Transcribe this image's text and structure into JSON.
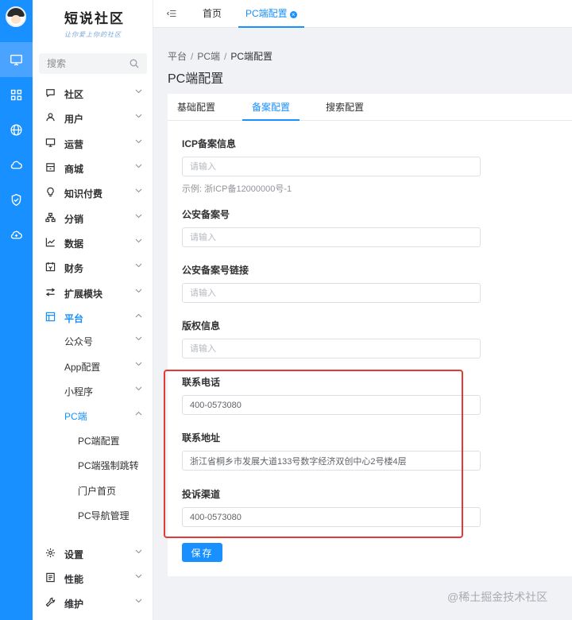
{
  "app": {
    "logo_title": "短说社区",
    "logo_subtitle": "让你爱上你的社区"
  },
  "rail": {
    "items": [
      {
        "icon": "monitor-icon",
        "active": true
      },
      {
        "icon": "grid-icon",
        "active": false
      },
      {
        "icon": "globe-icon",
        "active": false
      },
      {
        "icon": "cloud-icon",
        "active": false
      },
      {
        "icon": "shield-check-icon",
        "active": false
      },
      {
        "icon": "cloud-sync-icon",
        "active": false
      }
    ]
  },
  "menu": {
    "search_placeholder": "搜索",
    "items": [
      {
        "label": "社区",
        "icon": "chat-icon"
      },
      {
        "label": "用户",
        "icon": "user-icon"
      },
      {
        "label": "运营",
        "icon": "screen-icon"
      },
      {
        "label": "商城",
        "icon": "shop-icon"
      },
      {
        "label": "知识付费",
        "icon": "bulb-icon"
      },
      {
        "label": "分销",
        "icon": "hierarchy-icon"
      },
      {
        "label": "数据",
        "icon": "chart-line-icon"
      },
      {
        "label": "财务",
        "icon": "finance-icon"
      },
      {
        "label": "扩展模块",
        "icon": "extend-icon"
      },
      {
        "label": "平台",
        "icon": "platform-icon",
        "active": true
      }
    ],
    "platform_children": [
      {
        "label": "公众号"
      },
      {
        "label": "App配置"
      },
      {
        "label": "小程序"
      },
      {
        "label": "PC端",
        "active": true
      }
    ],
    "pc_children": [
      "PC端配置",
      "PC端强制跳转",
      "门户首页",
      "PC导航管理"
    ],
    "bottom_items": [
      {
        "label": "设置",
        "icon": "gear-icon"
      },
      {
        "label": "性能",
        "icon": "performance-icon"
      },
      {
        "label": "维护",
        "icon": "wrench-icon"
      }
    ]
  },
  "topbar": {
    "tabs": [
      {
        "label": "首页"
      },
      {
        "label": "PC端配置",
        "active": true
      }
    ]
  },
  "breadcrumb": [
    "平台",
    "PC端",
    "PC端配置"
  ],
  "page_title": "PC端配置",
  "content_tabs": [
    {
      "label": "基础配置"
    },
    {
      "label": "备案配置",
      "active": true
    },
    {
      "label": "搜索配置"
    }
  ],
  "form": {
    "icp": {
      "label": "ICP备案信息",
      "value": "",
      "placeholder": "请输入",
      "hint": "示例: 浙ICP备12000000号-1"
    },
    "police": {
      "label": "公安备案号",
      "value": "",
      "placeholder": "请输入"
    },
    "police_link": {
      "label": "公安备案号链接",
      "value": "",
      "placeholder": "请输入"
    },
    "copyright": {
      "label": "版权信息",
      "value": "",
      "placeholder": "请输入"
    },
    "phone": {
      "label": "联系电话",
      "value": "400-0573080",
      "placeholder": "请输入"
    },
    "address": {
      "label": "联系地址",
      "value": "浙江省桐乡市发展大道133号数字经济双创中心2号楼4层",
      "placeholder": "请输入"
    },
    "complaint": {
      "label": "投诉渠道",
      "value": "400-0573080",
      "placeholder": "请输入"
    },
    "save_label": "保存"
  },
  "watermark": "@稀土掘金技术社区",
  "colors": {
    "primary": "#1890ff",
    "highlight_box": "#e53935",
    "background": "#f0f2f5"
  }
}
